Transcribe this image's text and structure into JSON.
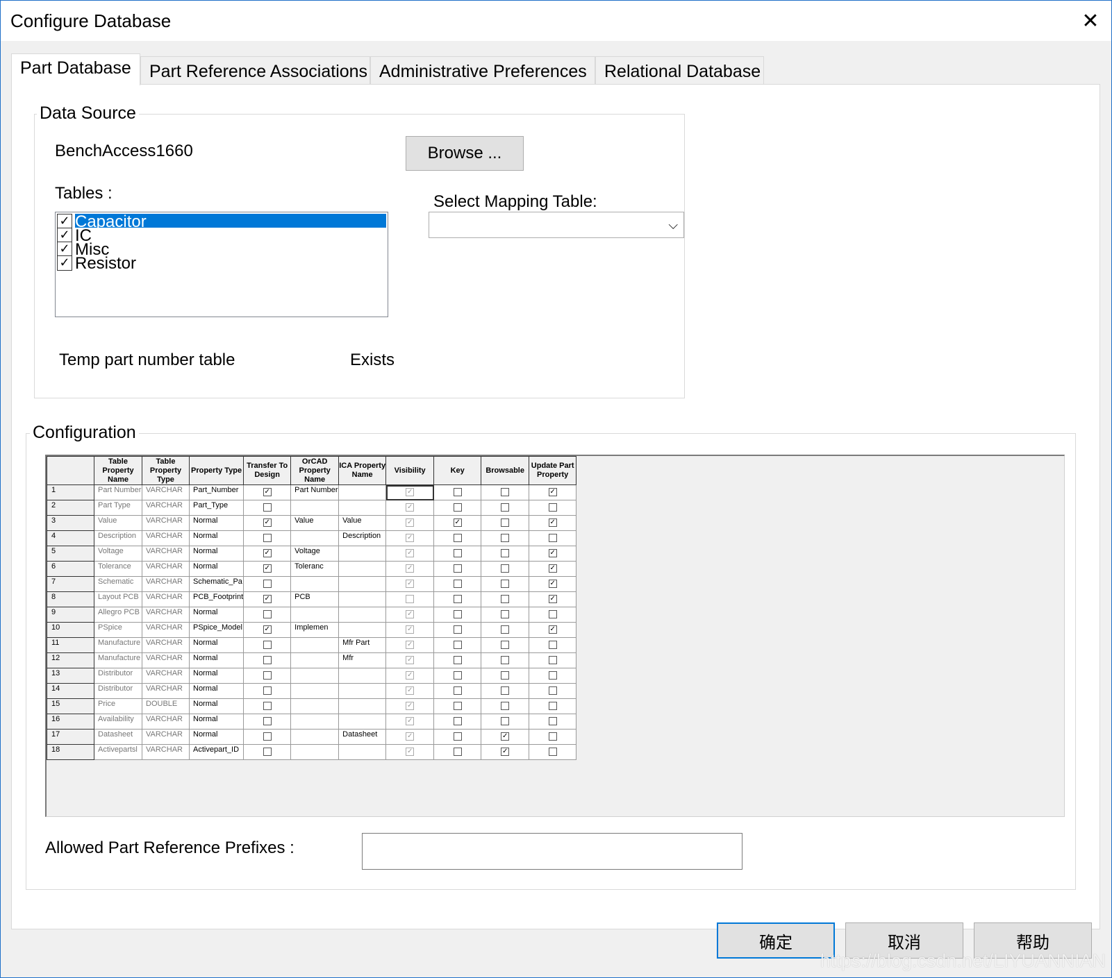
{
  "window": {
    "title": "Configure Database",
    "close_glyph": "✕"
  },
  "tabs": [
    {
      "label": "Part Database",
      "active": true
    },
    {
      "label": "Part Reference Associations"
    },
    {
      "label": "Administrative Preferences"
    },
    {
      "label": "Relational Database"
    }
  ],
  "data_source": {
    "legend": "Data Source",
    "source_name": "BenchAccess1660",
    "browse_label": "Browse ...",
    "tables_label": "Tables :",
    "tables": [
      {
        "name": "Capacitor",
        "checked": true,
        "selected": true
      },
      {
        "name": "IC",
        "checked": true
      },
      {
        "name": "Misc",
        "checked": true
      },
      {
        "name": "Resistor",
        "checked": true
      }
    ],
    "mapping_label": "Select Mapping Table:",
    "mapping_value": "",
    "temp_label": "Temp part number table",
    "temp_status": "Exists"
  },
  "configuration": {
    "legend": "Configuration",
    "columns": [
      "",
      "Table Property Name",
      "Table Property Type",
      "Property Type",
      "Transfer To Design",
      "OrCAD Property Name",
      "ICA Property Name",
      "Visibility",
      "Key",
      "Browsable",
      "Update Part Property"
    ],
    "rows": [
      {
        "n": "1",
        "name": "Part Number",
        "type": "VARCHAR",
        "ptype": "Part_Number",
        "transfer": true,
        "orcad": "Part Number",
        "ica": "",
        "vis": true,
        "key": false,
        "browse": false,
        "update": true
      },
      {
        "n": "2",
        "name": "Part Type",
        "type": "VARCHAR",
        "ptype": "Part_Type",
        "transfer": false,
        "orcad": "",
        "ica": "",
        "vis": true,
        "key": false,
        "browse": false,
        "update": false
      },
      {
        "n": "3",
        "name": "Value",
        "type": "VARCHAR",
        "ptype": "Normal",
        "transfer": true,
        "orcad": "Value",
        "ica": "Value",
        "vis": true,
        "key": true,
        "browse": false,
        "update": true
      },
      {
        "n": "4",
        "name": "Description",
        "type": "VARCHAR",
        "ptype": "Normal",
        "transfer": false,
        "orcad": "",
        "ica": "Description",
        "vis": true,
        "key": false,
        "browse": false,
        "update": false
      },
      {
        "n": "5",
        "name": "Voltage",
        "type": "VARCHAR",
        "ptype": "Normal",
        "transfer": true,
        "orcad": "Voltage",
        "ica": "",
        "vis": true,
        "key": false,
        "browse": false,
        "update": true
      },
      {
        "n": "6",
        "name": "Tolerance",
        "type": "VARCHAR",
        "ptype": "Normal",
        "transfer": true,
        "orcad": "Toleranc",
        "ica": "",
        "vis": true,
        "key": false,
        "browse": false,
        "update": true
      },
      {
        "n": "7",
        "name": "Schematic",
        "type": "VARCHAR",
        "ptype": "Schematic_Pa",
        "transfer": false,
        "orcad": "",
        "ica": "",
        "vis": true,
        "key": false,
        "browse": false,
        "update": true
      },
      {
        "n": "8",
        "name": "Layout PCB",
        "type": "VARCHAR",
        "ptype": "PCB_Footprint",
        "transfer": true,
        "orcad": "PCB",
        "ica": "",
        "vis": false,
        "key": false,
        "browse": false,
        "update": true
      },
      {
        "n": "9",
        "name": "Allegro PCB",
        "type": "VARCHAR",
        "ptype": "Normal",
        "transfer": false,
        "orcad": "",
        "ica": "",
        "vis": true,
        "key": false,
        "browse": false,
        "update": false
      },
      {
        "n": "10",
        "name": "PSpice",
        "type": "VARCHAR",
        "ptype": "PSpice_Model",
        "transfer": true,
        "orcad": "Implemen",
        "ica": "",
        "vis": true,
        "key": false,
        "browse": false,
        "update": true
      },
      {
        "n": "11",
        "name": "Manufacture",
        "type": "VARCHAR",
        "ptype": "Normal",
        "transfer": false,
        "orcad": "",
        "ica": "Mfr Part",
        "vis": true,
        "key": false,
        "browse": false,
        "update": false
      },
      {
        "n": "12",
        "name": "Manufacture",
        "type": "VARCHAR",
        "ptype": "Normal",
        "transfer": false,
        "orcad": "",
        "ica": "Mfr",
        "vis": true,
        "key": false,
        "browse": false,
        "update": false
      },
      {
        "n": "13",
        "name": "Distributor",
        "type": "VARCHAR",
        "ptype": "Normal",
        "transfer": false,
        "orcad": "",
        "ica": "",
        "vis": true,
        "key": false,
        "browse": false,
        "update": false
      },
      {
        "n": "14",
        "name": "Distributor",
        "type": "VARCHAR",
        "ptype": "Normal",
        "transfer": false,
        "orcad": "",
        "ica": "",
        "vis": true,
        "key": false,
        "browse": false,
        "update": false
      },
      {
        "n": "15",
        "name": "Price",
        "type": "DOUBLE",
        "ptype": "Normal",
        "transfer": false,
        "orcad": "",
        "ica": "",
        "vis": true,
        "key": false,
        "browse": false,
        "update": false
      },
      {
        "n": "16",
        "name": "Availability",
        "type": "VARCHAR",
        "ptype": "Normal",
        "transfer": false,
        "orcad": "",
        "ica": "",
        "vis": true,
        "key": false,
        "browse": false,
        "update": false
      },
      {
        "n": "17",
        "name": "Datasheet",
        "type": "VARCHAR",
        "ptype": "Normal",
        "transfer": false,
        "orcad": "",
        "ica": "Datasheet",
        "vis": true,
        "key": false,
        "browse": true,
        "update": false
      },
      {
        "n": "18",
        "name": "Activepartsl",
        "type": "VARCHAR",
        "ptype": "Activepart_ID",
        "transfer": false,
        "orcad": "",
        "ica": "",
        "vis": true,
        "key": false,
        "browse": true,
        "update": false
      }
    ],
    "prefixes_label": "Allowed Part Reference Prefixes :",
    "prefixes_value": ""
  },
  "buttons": {
    "ok": "确定",
    "cancel": "取消",
    "help": "帮助"
  },
  "watermark": "https://blog.csdn.net/LIYUANNIAN",
  "colors": {
    "accent": "#0078d7",
    "window_border": "#1e6fc8"
  }
}
